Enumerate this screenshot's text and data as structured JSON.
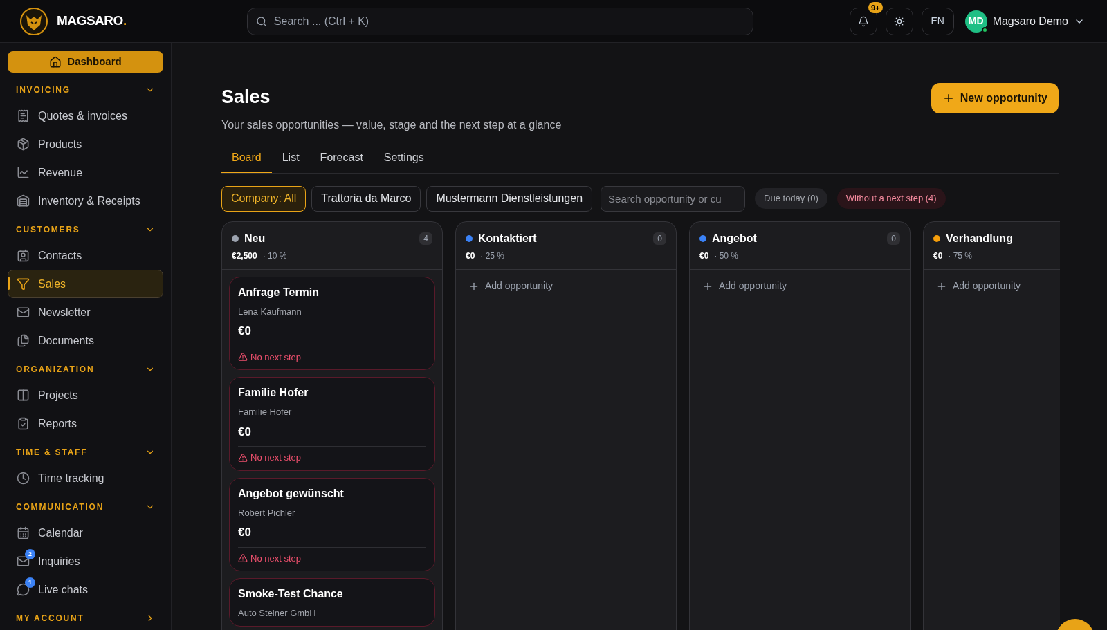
{
  "header": {
    "logo_text": "MAGSARO",
    "logo_accent": ".",
    "search": {
      "placeholder": "Search ... (Ctrl + K)"
    },
    "notifications_badge": "9+",
    "language": "EN",
    "user": {
      "initials": "MD",
      "name": "Magsaro Demo",
      "online": true
    }
  },
  "sidebar": {
    "dashboard": "Dashboard",
    "sections": [
      {
        "title": "INVOICING",
        "expanded": true,
        "items": [
          {
            "label": "Quotes & invoices",
            "selected": false
          },
          {
            "label": "Products",
            "selected": false
          },
          {
            "label": "Revenue",
            "selected": false
          },
          {
            "label": "Inventory & Receipts",
            "selected": false
          }
        ]
      },
      {
        "title": "CUSTOMERS",
        "expanded": true,
        "items": [
          {
            "label": "Contacts",
            "selected": false
          },
          {
            "label": "Sales",
            "selected": true
          },
          {
            "label": "Newsletter",
            "selected": false
          },
          {
            "label": "Documents",
            "selected": false
          }
        ]
      },
      {
        "title": "ORGANIZATION",
        "expanded": true,
        "items": [
          {
            "label": "Projects",
            "selected": false
          },
          {
            "label": "Reports",
            "selected": false
          }
        ]
      },
      {
        "title": "TIME & STAFF",
        "expanded": true,
        "items": [
          {
            "label": "Time tracking",
            "selected": false
          }
        ]
      },
      {
        "title": "COMMUNICATION",
        "expanded": true,
        "items": [
          {
            "label": "Calendar",
            "selected": false
          },
          {
            "label": "Inquiries",
            "selected": false,
            "badge": "2"
          },
          {
            "label": "Live chats",
            "selected": false,
            "badge": "1"
          }
        ]
      },
      {
        "title": "MY ACCOUNT",
        "expanded": false
      }
    ]
  },
  "page": {
    "title": "Sales",
    "subtitle": "Your sales opportunities — value, stage and the next step at a glance",
    "new_button": "New opportunity",
    "tabs": [
      {
        "label": "Board",
        "selected": true
      },
      {
        "label": "List",
        "selected": false
      },
      {
        "label": "Forecast",
        "selected": false
      },
      {
        "label": "Settings",
        "selected": false
      }
    ],
    "filters": [
      {
        "label": "Company: All",
        "selected": true
      },
      {
        "label": "Trattoria da Marco",
        "selected": false
      },
      {
        "label": "Mustermann Dienstleistungen",
        "selected": false
      }
    ],
    "search": {
      "placeholder": "Search opportunity or cu"
    },
    "quick_filters": [
      {
        "label": "Due today (0)",
        "kind": "neutral"
      },
      {
        "label": "Without a next step (4)",
        "kind": "alert"
      }
    ],
    "columns": [
      {
        "name": "Neu",
        "color": "#9ca3af",
        "count": "4",
        "value": "€2,500",
        "percent": "· 10 %",
        "cards": [
          {
            "title": "Anfrage Termin",
            "contact": "Lena Kaufmann",
            "amount": "€0",
            "warning": "No next step"
          },
          {
            "title": "Familie Hofer",
            "contact": "Familie Hofer",
            "amount": "€0",
            "warning": "No next step"
          },
          {
            "title": "Angebot gewünscht",
            "contact": "Robert Pichler",
            "amount": "€0",
            "warning": "No next step"
          },
          {
            "title": "Smoke-Test Chance",
            "contact": "Auto Steiner GmbH"
          }
        ]
      },
      {
        "name": "Kontaktiert",
        "color": "#3b82f6",
        "count": "0",
        "value": "€0",
        "percent": "· 25 %",
        "add_label": "Add opportunity"
      },
      {
        "name": "Angebot",
        "color": "#3b82f6",
        "count": "0",
        "value": "€0",
        "percent": "· 50 %",
        "add_label": "Add opportunity"
      },
      {
        "name": "Verhandlung",
        "color": "#f59e0b",
        "value": "€0",
        "percent": "· 75 %",
        "add_label": "Add opportunity"
      }
    ]
  }
}
